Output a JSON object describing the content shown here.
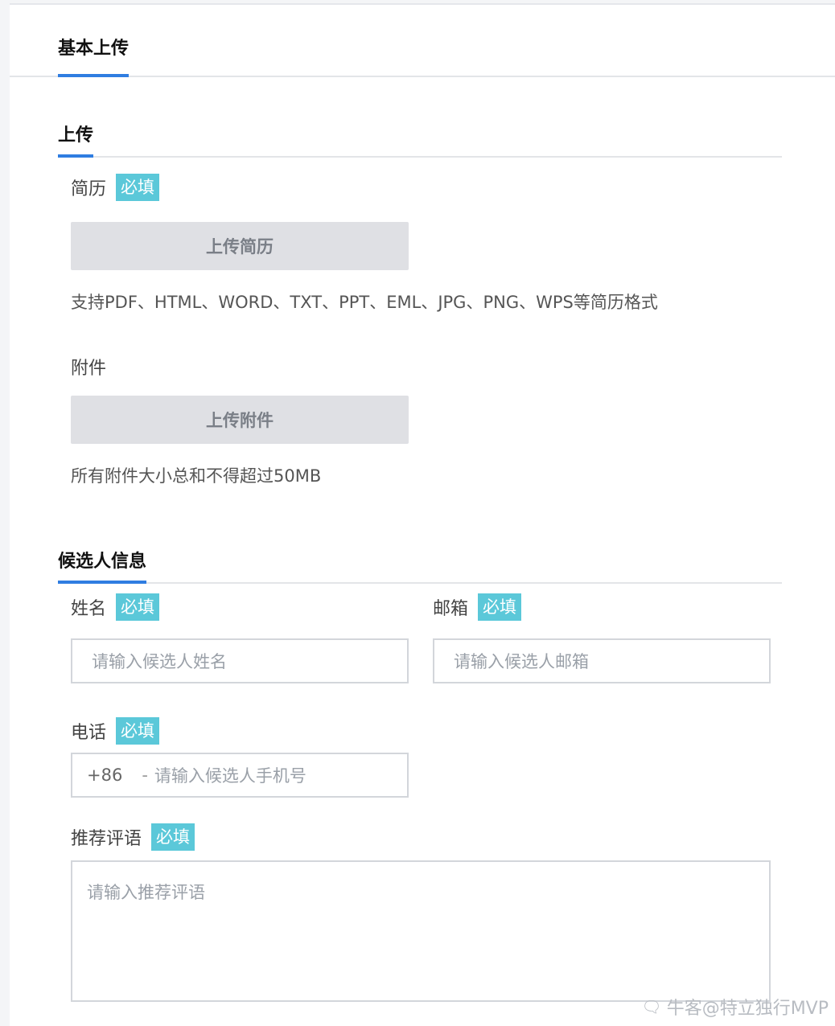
{
  "tabs": {
    "active": "基本上传"
  },
  "sections": {
    "upload": {
      "title": "上传"
    },
    "candidate": {
      "title": "候选人信息"
    }
  },
  "required_badge": "必填",
  "resume": {
    "label": "简历",
    "button": "上传简历",
    "hint": "支持PDF、HTML、WORD、TXT、PPT、EML、JPG、PNG、WPS等简历格式"
  },
  "attachment": {
    "label": "附件",
    "button": "上传附件",
    "hint": "所有附件大小总和不得超过50MB"
  },
  "name": {
    "label": "姓名",
    "placeholder": "请输入候选人姓名"
  },
  "email": {
    "label": "邮箱",
    "placeholder": "请输入候选人邮箱"
  },
  "phone": {
    "label": "电话",
    "prefix": "+86",
    "separator": "-",
    "placeholder": "请输入候选人手机号"
  },
  "comment": {
    "label": "推荐评语",
    "placeholder": "请输入推荐评语"
  },
  "watermark": {
    "icon": "chat-bubble-icon",
    "text": "牛客@特立独行MVP"
  }
}
